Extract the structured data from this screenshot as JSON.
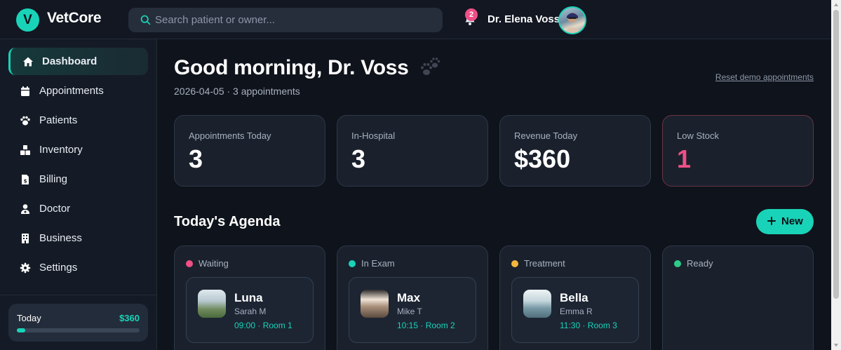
{
  "app": {
    "name": "VetCore",
    "logo_letter": "V",
    "accent": "#19d3b8"
  },
  "search": {
    "placeholder": "Search patient or owner..."
  },
  "notifications": {
    "count": "2"
  },
  "user": {
    "name": "Dr. Elena Voss"
  },
  "sidebar": {
    "items": [
      {
        "label": "Dashboard",
        "icon": "home-icon",
        "active": true
      },
      {
        "label": "Appointments",
        "icon": "calendar-icon"
      },
      {
        "label": "Patients",
        "icon": "paw-icon"
      },
      {
        "label": "Inventory",
        "icon": "boxes-icon"
      },
      {
        "label": "Billing",
        "icon": "invoice-icon"
      },
      {
        "label": "Doctor",
        "icon": "doctor-icon"
      },
      {
        "label": "Business",
        "icon": "building-icon"
      },
      {
        "label": "Settings",
        "icon": "gear-icon"
      }
    ],
    "today": {
      "label": "Today",
      "value": "$360",
      "progress_fraction": 0.07
    }
  },
  "main": {
    "greeting": "Good morning, Dr. Voss",
    "subline": "2026-04-05 · 3 appointments",
    "reset_link": "Reset demo appointments",
    "stats": [
      {
        "label": "Appointments Today",
        "value": "3"
      },
      {
        "label": "In-Hospital",
        "value": "3"
      },
      {
        "label": "Revenue Today",
        "value": "$360"
      },
      {
        "label": "Low Stock",
        "value": "1",
        "alert": true
      }
    ],
    "agenda_title": "Today's Agenda",
    "new_button": "New",
    "columns": [
      {
        "title": "Waiting",
        "dot_color": "#ef4f86",
        "appointment": {
          "name": "Luna",
          "owner": "Sarah M",
          "time": "09:00 · Room 1"
        }
      },
      {
        "title": "In Exam",
        "dot_color": "#19d3b8",
        "appointment": {
          "name": "Max",
          "owner": "Mike T",
          "time": "10:15 · Room 2"
        }
      },
      {
        "title": "Treatment",
        "dot_color": "#f4b73d",
        "appointment": {
          "name": "Bella",
          "owner": "Emma R",
          "time": "11:30 · Room 3"
        }
      },
      {
        "title": "Ready",
        "dot_color": "#2ecc8a"
      }
    ]
  }
}
